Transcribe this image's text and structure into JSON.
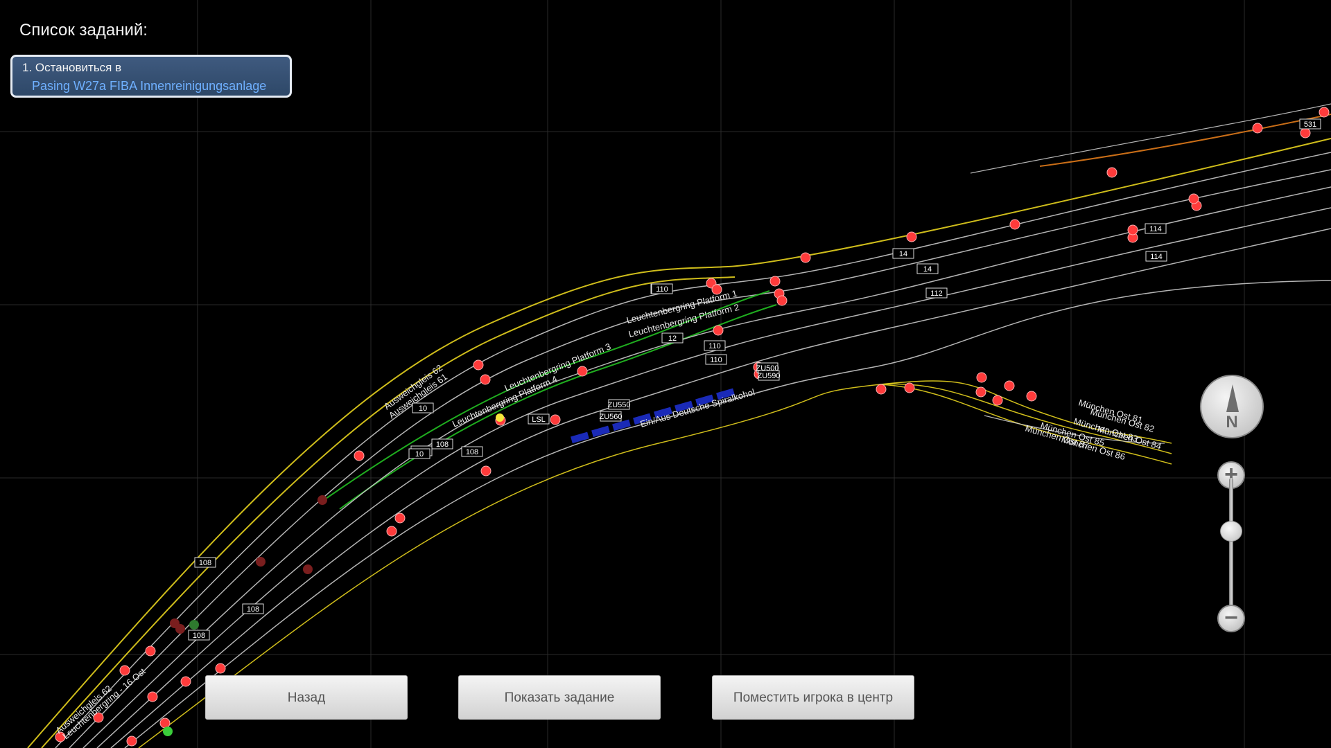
{
  "task_panel": {
    "title": "Список заданий:",
    "task": {
      "line1": "1. Остановиться в",
      "line2": "Pasing W27a FIBA Innenreinigungsanlage"
    }
  },
  "buttons": {
    "back": "Назад",
    "show_task": "Показать задание",
    "center_player": "Поместить игрока в центр"
  },
  "compass": {
    "letter": "N",
    "icon": "compass-north-icon"
  },
  "zoom": {
    "in_icon": "plus-icon",
    "out_icon": "minus-icon",
    "in_label": "+",
    "out_label": "−",
    "level": 0.35
  },
  "map": {
    "track_labels": [
      "Leuchtenbergring Platform 1",
      "Leuchtenbergring Platform 2",
      "Leuchtenbergring Platform 3",
      "Leuchtenbergring Platform 4",
      "Ausweichgleis 62",
      "Ausweichgleis 61",
      "Ein/Aus Deutsche Spiralkohol",
      "München Ost 81",
      "München Ost 82",
      "München Ost 83",
      "München Ost 84",
      "München Ost 85",
      "München Ost 86",
      "München Ost 87",
      "Ausweichgleis 62",
      "Leuchtenbergring - 16 Ost"
    ],
    "speed_signs": [
      "110",
      "110",
      "110",
      "110",
      "10",
      "10",
      "10",
      "108",
      "108",
      "108",
      "108",
      "108",
      "12",
      "14",
      "14",
      "112",
      "114",
      "114",
      "531",
      "ZU550",
      "ZU560",
      "LSL",
      "ZU500",
      "ZU590"
    ],
    "colors": {
      "background": "#000000",
      "grid": "#2a2a2a",
      "track": "#c8c8c8",
      "platform": "#e6d21e",
      "route": "#22c022",
      "train": "#1a2ab8",
      "signal_red": "#ff3b3b",
      "signal_green": "#3acd3a",
      "orange_track": "#e07a1a"
    }
  }
}
